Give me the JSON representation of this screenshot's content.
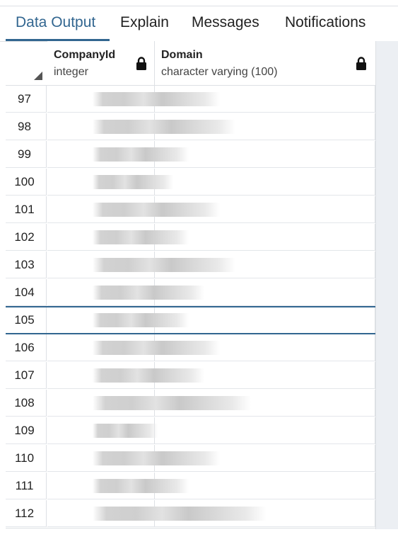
{
  "tabs": [
    {
      "label": "Data Output",
      "active": true
    },
    {
      "label": "Explain",
      "active": false
    },
    {
      "label": "Messages",
      "active": false
    },
    {
      "label": "Notifications",
      "active": false
    }
  ],
  "columns": [
    {
      "name": "CompanyId",
      "type": "integer",
      "locked": true
    },
    {
      "name": "Domain",
      "type": "character varying (100)",
      "locked": true
    }
  ],
  "rows": [
    "97",
    "98",
    "99",
    "100",
    "101",
    "102",
    "103",
    "104",
    "105",
    "106",
    "107",
    "108",
    "109",
    "110",
    "111",
    "112"
  ],
  "selected_row": "105",
  "colors": {
    "accent": "#326690",
    "grid_line": "#dde0e4",
    "redacted": "#d2d2d2"
  }
}
